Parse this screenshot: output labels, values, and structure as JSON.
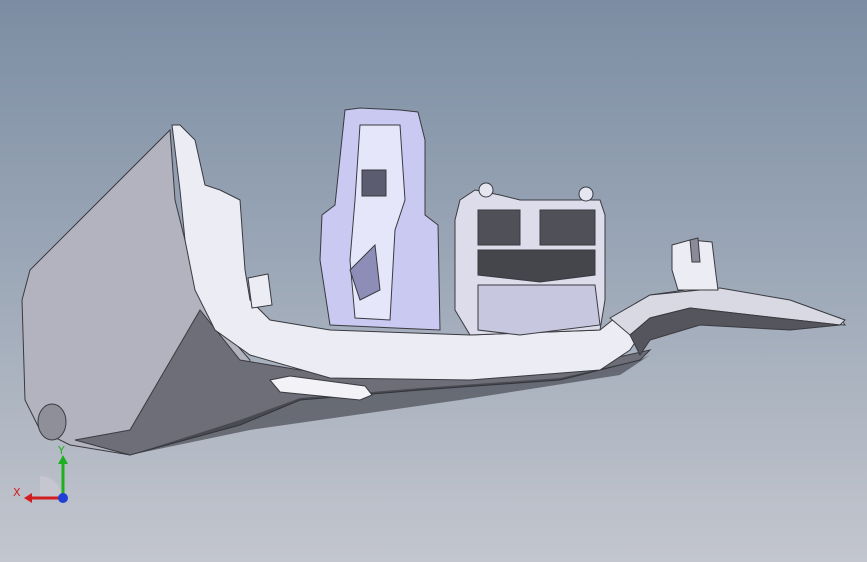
{
  "viewport": {
    "background_top": "#7c8da3",
    "background_bottom": "#c3c6ce",
    "part_color": "#e9e9f2",
    "part_shadow": "#9c9ca8",
    "part_dark": "#505058",
    "part_highlight": "#c6c6f0"
  },
  "triad": {
    "x_label": "X",
    "y_label": "Y",
    "x_color": "#d21e1e",
    "y_color": "#1fb01f",
    "z_color": "#1f3fd8"
  }
}
